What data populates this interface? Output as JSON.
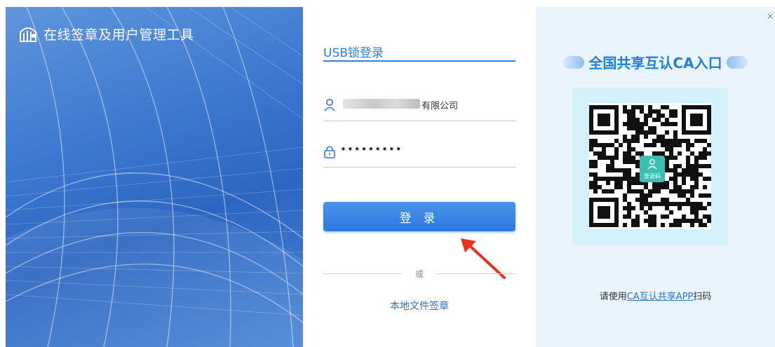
{
  "app": {
    "title": "在线签章及用户管理工具"
  },
  "login": {
    "tab_label": "USB锁登录",
    "username_value": "有限公司",
    "password_value": "•••••••••",
    "submit_label": "登 录",
    "divider_text": "或",
    "local_sign_link": "本地文件签章"
  },
  "ca": {
    "title": "全国共享互认CA入口",
    "qr_badge_label": "登录码",
    "scan_prefix": "请使用",
    "scan_link": "CA互认共享APP",
    "scan_suffix": "扫码",
    "close_glyph": "×"
  },
  "colors": {
    "accent": "#2e7bd8",
    "button": "#2c79e0",
    "panel_bg": "#e9f4fd",
    "qr_bg": "#d3f1f8",
    "badge": "#3bbfb2",
    "arrow": "#e8321e"
  },
  "icons": {
    "brand": "app-logo-icon",
    "user": "user-icon",
    "lock": "lock-icon",
    "arrow": "annotation-arrow-icon",
    "qr": "qr-code-icon",
    "close": "close-icon"
  }
}
